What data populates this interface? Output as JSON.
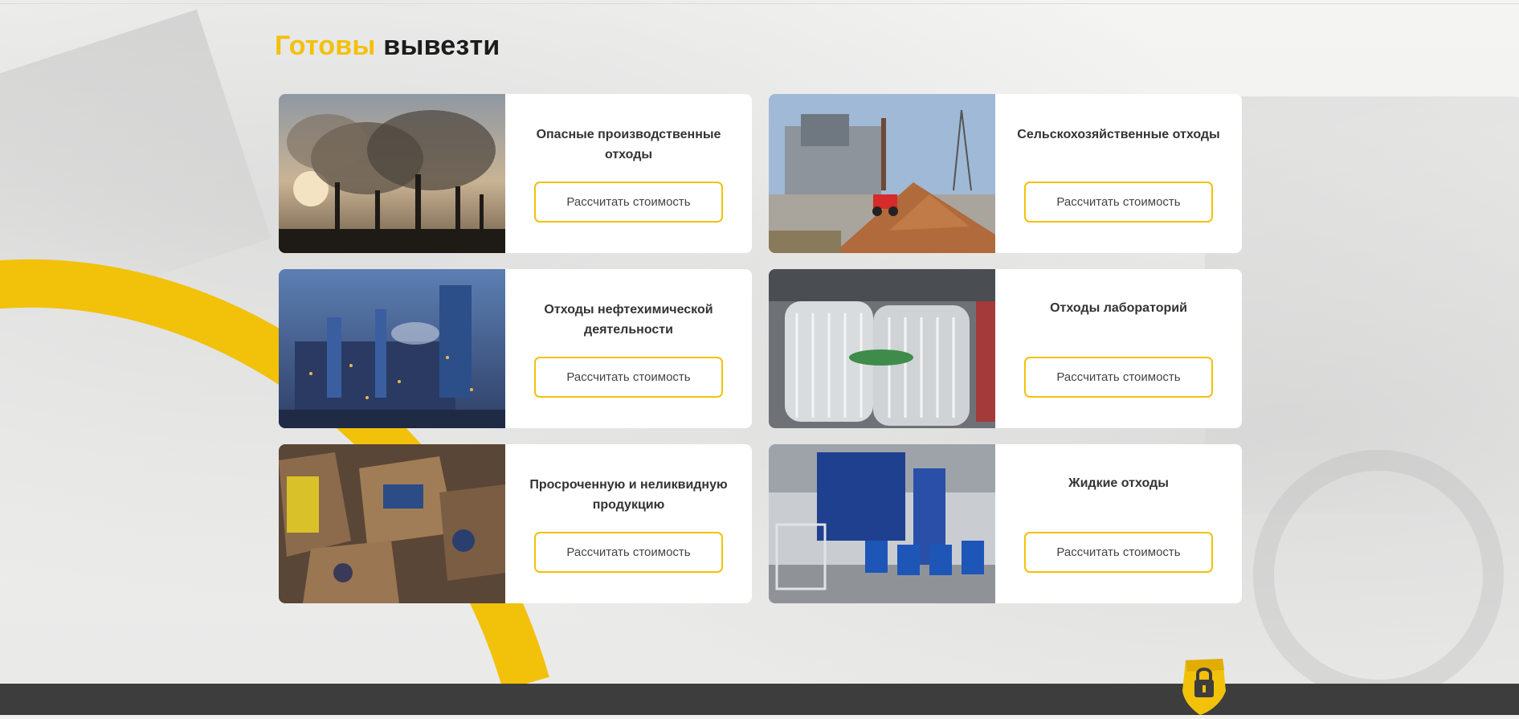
{
  "section": {
    "title_accent": "Готовы",
    "title_rest": " вывезти"
  },
  "cards": [
    {
      "title": "Опасные производственные отходы",
      "button": "Рассчитать стоимость",
      "image": "factory-smoke-image"
    },
    {
      "title": "Сельскохозяйственные отходы",
      "button": "Рассчитать стоимость",
      "image": "wood-chips-plant-image"
    },
    {
      "title": "Отходы нефтехимической деятельности",
      "button": "Рассчитать стоимость",
      "image": "petrochemical-plant-image"
    },
    {
      "title": "Отходы лабораторий",
      "button": "Рассчитать стоимость",
      "image": "fluorescent-tubes-image"
    },
    {
      "title": "Просроченную и неликвидную продукцию",
      "button": "Рассчитать стоимость",
      "image": "boxes-products-image"
    },
    {
      "title": "Жидкие отходы",
      "button": "Рассчитать стоимость",
      "image": "liquid-processing-line-image"
    }
  ],
  "colors": {
    "accent": "#f2c10a",
    "title": "#1c1c1c",
    "card_text": "#333333",
    "footer": "#3d3d3d"
  },
  "widgets": {
    "lock_icon": "lock-shield-icon"
  }
}
